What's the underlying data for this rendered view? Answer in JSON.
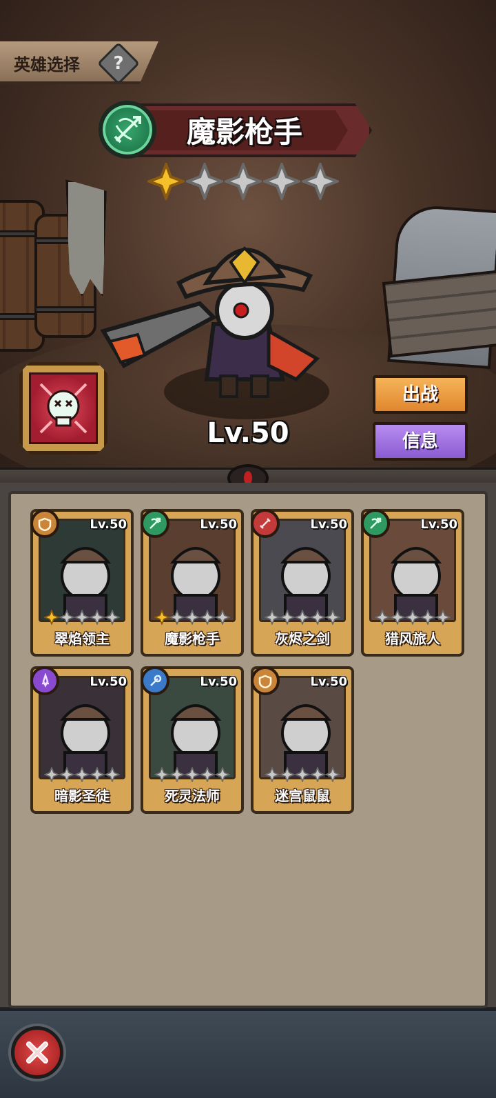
{
  "header": {
    "title": "英雄选择",
    "help_icon": "question-icon"
  },
  "selected_hero": {
    "name": "魔影枪手",
    "class_icon": "bow-icon",
    "class_color": "#2e9a61",
    "stars": 1,
    "max_stars": 5,
    "level": "Lv.50",
    "skill_icon": "skull-icon"
  },
  "actions": {
    "battle_label": "出战",
    "info_label": "信息",
    "close_icon": "close-icon"
  },
  "roster": [
    {
      "name": "翠焰领主",
      "level": "Lv.50",
      "class_icon": "shield-icon",
      "class_color": "#c9853a",
      "stars": 1
    },
    {
      "name": "魔影枪手",
      "level": "Lv.50",
      "class_icon": "bow-icon",
      "class_color": "#2e9a61",
      "stars": 1
    },
    {
      "name": "灰烬之剑",
      "level": "Lv.50",
      "class_icon": "sword-icon",
      "class_color": "#c23a3a",
      "stars": 0
    },
    {
      "name": "猎风旅人",
      "level": "Lv.50",
      "class_icon": "bow-icon",
      "class_color": "#2e9a61",
      "stars": 0
    },
    {
      "name": "暗影圣徒",
      "level": "Lv.50",
      "class_icon": "dagger-icon",
      "class_color": "#8a4ad0",
      "stars": 0
    },
    {
      "name": "死灵法师",
      "level": "Lv.50",
      "class_icon": "staff-icon",
      "class_color": "#3a7ac8",
      "stars": 0
    },
    {
      "name": "迷宫鼠鼠",
      "level": "Lv.50",
      "class_icon": "shield-icon",
      "class_color": "#c9853a",
      "stars": 0
    }
  ]
}
